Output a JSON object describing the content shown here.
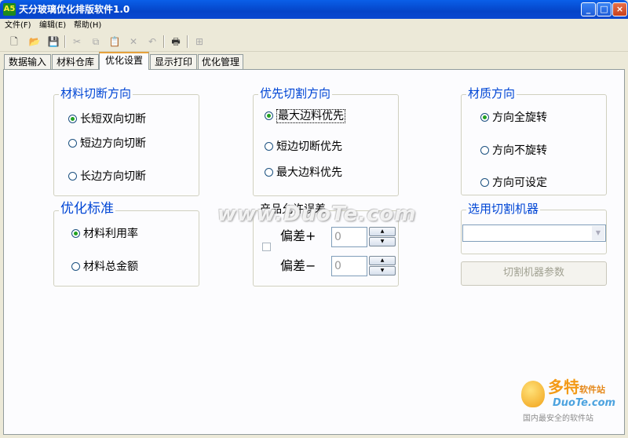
{
  "window": {
    "title": "天分玻璃优化排版软件1.0",
    "app_icon_text": "A5"
  },
  "menu": [
    {
      "label": "文件(F)"
    },
    {
      "label": "编辑(E)"
    },
    {
      "label": "帮助(H)"
    }
  ],
  "toolbar": {
    "icons": [
      "new-file-icon",
      "open-folder-icon",
      "save-icon",
      "cut-icon",
      "copy-icon",
      "paste-icon",
      "delete-icon",
      "undo-icon",
      "print-icon",
      "grid-icon"
    ]
  },
  "tabs": [
    {
      "label": "数据输入"
    },
    {
      "label": "材料仓库"
    },
    {
      "label": "优化设置",
      "active": true
    },
    {
      "label": "显示打印"
    },
    {
      "label": "优化管理"
    }
  ],
  "groups": {
    "cut_direction": {
      "title": "材料切断方向",
      "options": [
        {
          "label": "长短双向切断",
          "selected": true
        },
        {
          "label": "短边方向切断",
          "selected": false
        },
        {
          "label": "长边方向切断",
          "selected": false
        }
      ]
    },
    "priority": {
      "title": "优先切割方向",
      "options": [
        {
          "label": "最大边料优先",
          "selected": true
        },
        {
          "label": "短边切断优先",
          "selected": false
        },
        {
          "label": "最大边料优先",
          "selected": false
        }
      ]
    },
    "material_direction": {
      "title": "材质方向",
      "options": [
        {
          "label": "方向全旋转",
          "selected": true
        },
        {
          "label": "方向不旋转",
          "selected": false
        },
        {
          "label": "方向可设定",
          "selected": false
        }
      ]
    },
    "criterion": {
      "title": "优化标准",
      "options": [
        {
          "label": "材料利用率",
          "selected": true
        },
        {
          "label": "材料总金额",
          "selected": false
        }
      ]
    },
    "tolerance": {
      "title": "产品允许误差",
      "plus_label": "偏差+",
      "plus_value": "0",
      "minus_label": "偏差−",
      "minus_value": "0",
      "checked": false
    },
    "machine": {
      "title": "选用切割机器",
      "selected": "",
      "params_button": "切割机器参数"
    }
  },
  "watermark": "www.DuoTe.com",
  "logo": {
    "cn": "多特",
    "cn_small": "软件站",
    "en": "DuoTe.com",
    "slogan": "国内最安全的软件站"
  }
}
